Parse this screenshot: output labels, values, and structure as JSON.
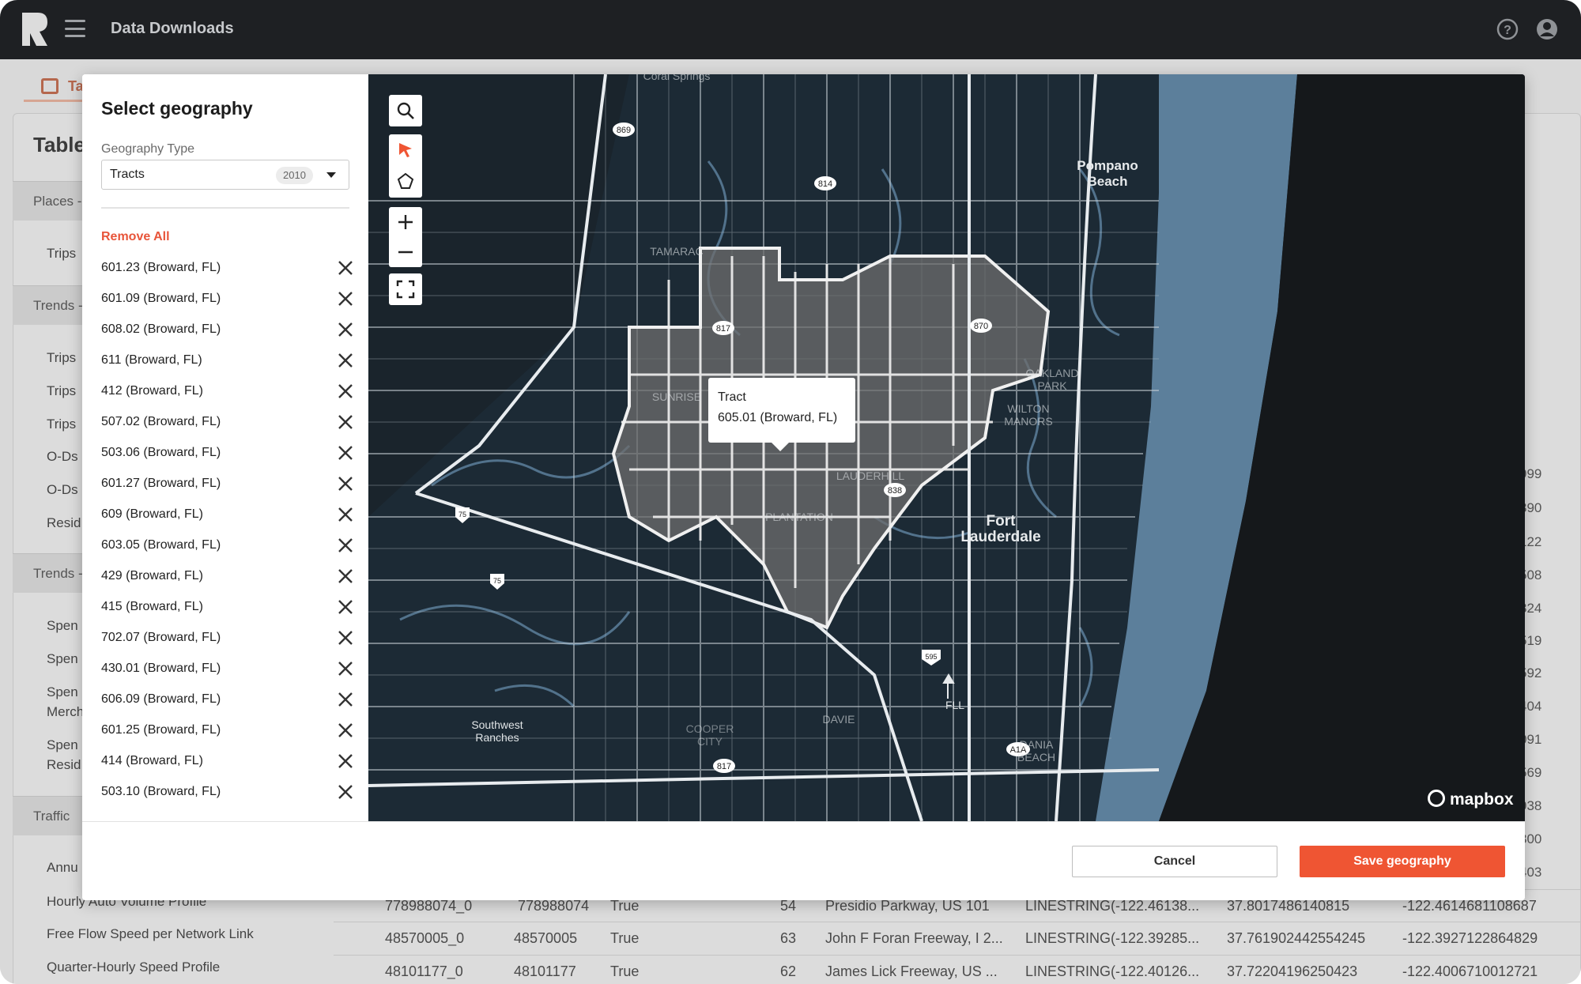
{
  "app": {
    "title": "Data Downloads"
  },
  "background": {
    "tab_label": "Ta",
    "card_title": "Table",
    "sections": [
      {
        "label": "Places -",
        "items": [
          "Trips"
        ]
      },
      {
        "label": "Trends -",
        "items": [
          "Trips",
          "Trips",
          "Trips",
          "O-Ds",
          "O-Ds",
          "Resid"
        ]
      },
      {
        "label": "Trends -",
        "items": [
          "Spen",
          "Spen",
          "Spen",
          "Merch",
          "Spen",
          "Resid"
        ]
      },
      {
        "label": "Traffic",
        "items": [
          "Annu",
          "Hourly Auto Volume Profile",
          "Free Flow Speed per Network Link",
          "Quarter-Hourly Speed Profile"
        ]
      }
    ],
    "table_rows": [
      [
        "778988074_0",
        "778988074",
        "True",
        "54",
        "Presidio Parkway, US 101",
        "LINESTRING(-122.46138...",
        "37.8017486140815",
        "-122.4614681108687"
      ],
      [
        "48570005_0",
        "48570005",
        "True",
        "63",
        "John F Foran Freeway, I 2...",
        "LINESTRING(-122.39285...",
        "37.761902442554245",
        "-122.3927122864829"
      ],
      [
        "48101177_0",
        "48101177",
        "True",
        "62",
        "James Lick Freeway, US ...",
        "LINESTRING(-122.40126...",
        "37.72204196250423",
        "-122.4006710012721"
      ]
    ],
    "right_column_fragments": [
      "999",
      "390",
      "122",
      "508",
      "324",
      "519",
      "592",
      "404",
      "091",
      "569",
      "938",
      "300",
      "403"
    ]
  },
  "modal": {
    "title": "Select geography",
    "geography_type_label": "Geography Type",
    "geography_type_value": "Tracts",
    "geography_year": "2010",
    "remove_all_label": "Remove All",
    "selected_geographies": [
      "601.23 (Broward, FL)",
      "601.09 (Broward, FL)",
      "608.02 (Broward, FL)",
      "611 (Broward, FL)",
      "412 (Broward, FL)",
      "507.02 (Broward, FL)",
      "503.06 (Broward, FL)",
      "601.27 (Broward, FL)",
      "609 (Broward, FL)",
      "603.05 (Broward, FL)",
      "429 (Broward, FL)",
      "415 (Broward, FL)",
      "702.07 (Broward, FL)",
      "430.01 (Broward, FL)",
      "606.09 (Broward, FL)",
      "601.25 (Broward, FL)",
      "414 (Broward, FL)",
      "503.10 (Broward, FL)"
    ],
    "cancel_label": "Cancel",
    "save_label": "Save geography"
  },
  "map": {
    "tooltip_title": "Tract",
    "tooltip_value": "605.01 (Broward, FL)",
    "labels": {
      "pompano": "Pompano\nBeach",
      "fort_lauderdale": "Fort\nLauderdale",
      "southwest_ranches": "Southwest\nRanches",
      "tamarac": "TAMARAC",
      "plantation": "PLANTATION",
      "lauderhill": "LAUDERHILL",
      "sunrise": "SUNRISE",
      "oakland_park": "OAKLAND\nPARK",
      "wilton_manors": "WILTON\nMANORS",
      "davie": "DAVIE",
      "cooper_city": "COOPER\nCITY",
      "dania_beach": "DANIA\nBEACH",
      "fll": "FLL",
      "coral_springs": "Coral Springs"
    },
    "shields": [
      "869",
      "814",
      "817",
      "870",
      "838",
      "75",
      "75",
      "595",
      "817",
      "A1A"
    ],
    "attribution": "mapbox",
    "colors": {
      "land": "#1c2a35",
      "water": "#5c7f9b",
      "ocean": "#5c7f9b",
      "selected": "#6e6e6e",
      "accent": "#ef5533"
    }
  }
}
